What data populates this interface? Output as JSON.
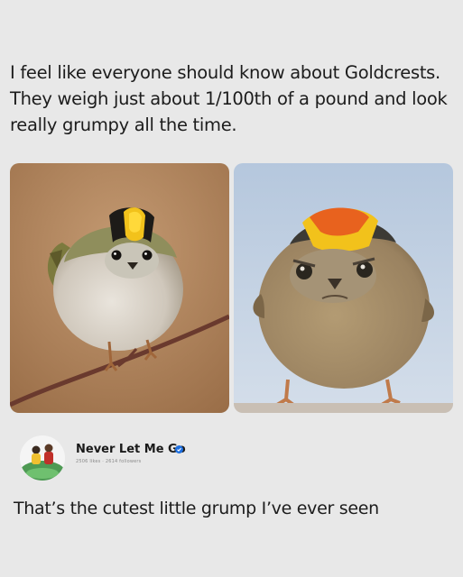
{
  "post": {
    "lines": [
      "I feel like everyone should know about Goldcrests.",
      "They weigh just about 1/100th of a pound and look",
      "really grumpy all the time."
    ]
  },
  "images": [
    {
      "subject": "goldcrest-on-branch"
    },
    {
      "subject": "goldcrest-grumpy-closeup"
    }
  ],
  "profile": {
    "name": "Never Let Me Go",
    "stats": "2506 likes · 2614 followers",
    "verified": true
  },
  "comment": {
    "text": "That’s the cutest little grump I’ve ever seen"
  },
  "colors": {
    "background": "#e8e8e8",
    "verified_badge": "#1d6fe0",
    "crest_yellow": "#f2c21b",
    "crest_orange": "#e8621e"
  }
}
